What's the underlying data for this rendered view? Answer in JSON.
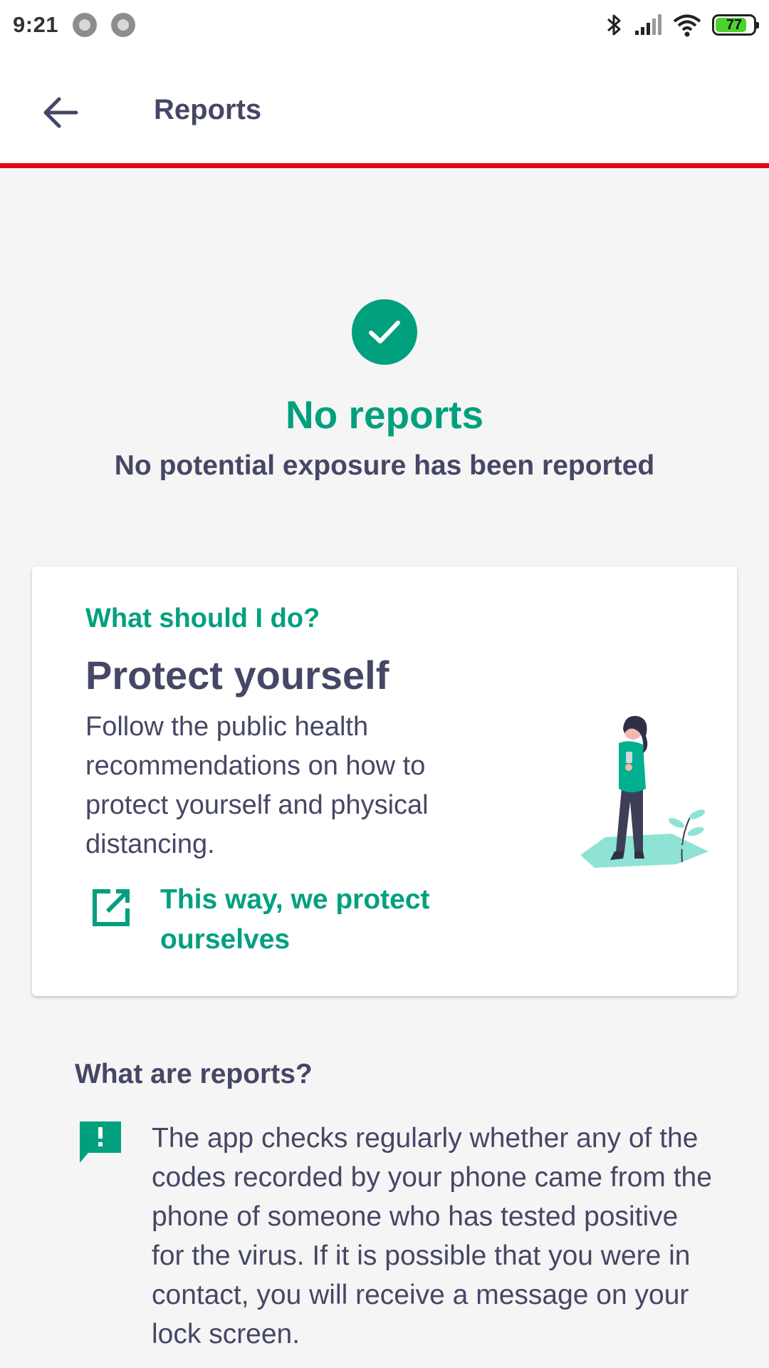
{
  "status_bar": {
    "time": "9:21",
    "battery": "77"
  },
  "app_bar": {
    "title": "Reports",
    "back_icon": "arrow-left-icon"
  },
  "hero": {
    "icon": "check-circle-icon",
    "title": "No reports",
    "subtitle": "No potential exposure has been reported"
  },
  "card": {
    "eyebrow": "What should I do?",
    "title": "Protect yourself",
    "body": "Follow the public health recommendations on how to protect yourself and physical distancing.",
    "link_label": "This way, we protect ourselves",
    "link_icon": "external-link-icon",
    "illustration": "woman-with-phone-illustration"
  },
  "section": {
    "title": "What are reports?",
    "icon": "message-alert-icon",
    "body": "The app checks regularly whether any of the codes recorded by your phone came from the phone of someone who has tested positive for the virus. If it is possible that you were in contact, you will receive a message on your lock screen."
  },
  "colors": {
    "accent": "#00a07f",
    "text": "#464766",
    "brand_red": "#e30613",
    "background": "#f5f5f5"
  }
}
